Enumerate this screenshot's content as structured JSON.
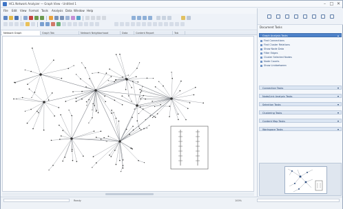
{
  "window": {
    "title": "HCL Network Analyzer — Graph View - Untitled 1",
    "controls": [
      "–",
      "□",
      "✕"
    ]
  },
  "menu": [
    "File",
    "Edit",
    "View",
    "Format",
    "Tools",
    "Analysis",
    "Data",
    "Window",
    "Help"
  ],
  "tabs": [
    "Network Graph",
    "Graph Tab",
    "Network Neighborhood",
    "Data",
    "Content Report",
    "Tab"
  ],
  "side_panel": {
    "title": "Document Tasks",
    "sections": [
      {
        "label": "Graph Analysis Tasks",
        "open": true,
        "items": [
          "Find Connections",
          "Find Cluster Relations",
          "Show Node Data",
          "Filter Edges",
          "Cluster Selected Nodes",
          "Node Counts",
          "Show Linkbetween"
        ]
      },
      {
        "label": "Connection Tasks",
        "open": false,
        "items": []
      },
      {
        "label": "Node/Link Analysis Tasks",
        "open": false,
        "items": []
      },
      {
        "label": "Selection Tasks",
        "open": false,
        "items": []
      },
      {
        "label": "Clustering Tasks",
        "open": false,
        "items": []
      },
      {
        "label": "Content Map Tasks",
        "open": false,
        "items": []
      },
      {
        "label": "Workspace Tasks",
        "open": false,
        "items": []
      }
    ]
  },
  "status": {
    "left": "Ready",
    "right": "100%"
  },
  "icons": {
    "app": "app-icon",
    "panel_chevron": "chevron-down-icon",
    "panel_chevron_up": "chevron-up-icon"
  },
  "colors": {
    "accent": "#4e82c9",
    "panel": "#dce6f3"
  }
}
